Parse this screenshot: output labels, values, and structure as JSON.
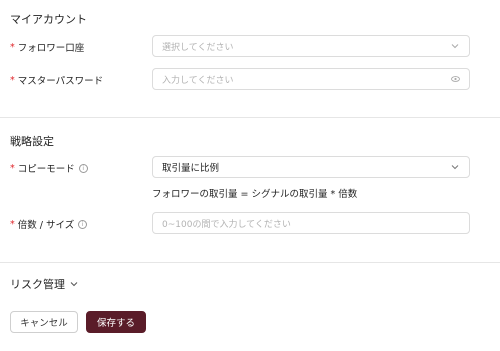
{
  "account_section": {
    "title": "マイアカウント",
    "follower_account": {
      "label": "フォロワー口座",
      "placeholder": "選択してください"
    },
    "master_password": {
      "label": "マスターパスワード",
      "placeholder": "入力してください"
    }
  },
  "strategy_section": {
    "title": "戦略設定",
    "copy_mode": {
      "label": "コピーモード",
      "value": "取引量に比例",
      "hint": "フォロワーの取引量 = シグナルの取引量 * 倍数"
    },
    "multiplier": {
      "label": "倍数 / サイズ",
      "placeholder": "0~100の間で入力してください"
    }
  },
  "risk_section": {
    "title": "リスク管理"
  },
  "actions": {
    "cancel_label": "キャンセル",
    "save_label": "保存する"
  },
  "colors": {
    "required": "#e0262b",
    "primary": "#5a1c29"
  }
}
